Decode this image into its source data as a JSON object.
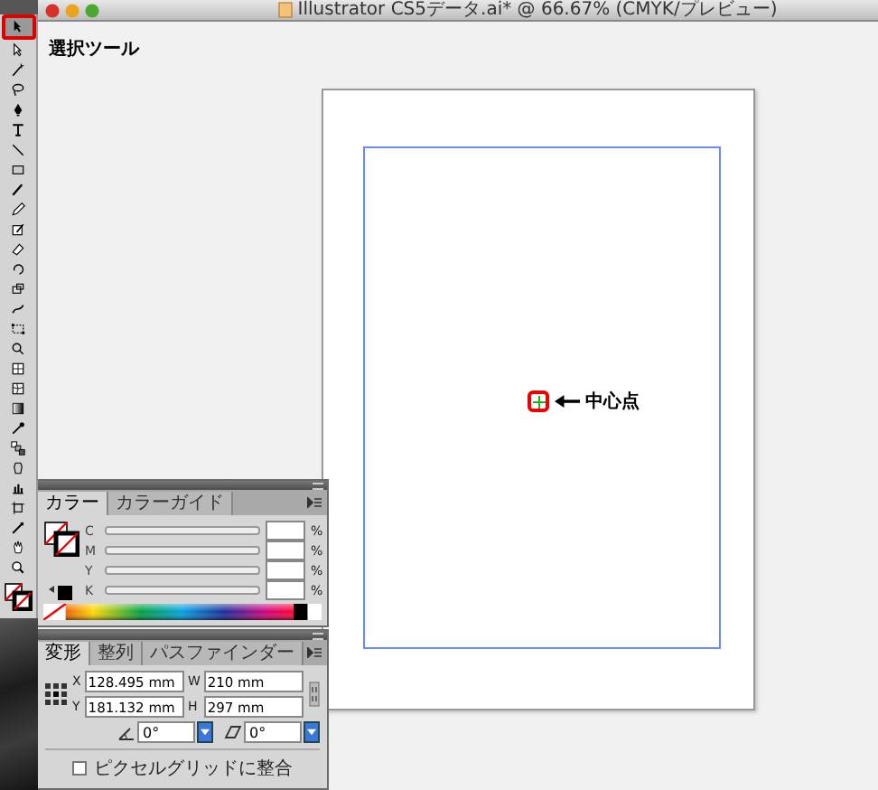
{
  "window": {
    "title": "Illustrator CS5データ.ai* @ 66.67% (CMYK/プレビュー)"
  },
  "tools": [
    {
      "kind": "arrow",
      "selected": true
    },
    {
      "kind": "direct",
      "selected": false
    },
    {
      "kind": "wand",
      "selected": false
    },
    {
      "kind": "lasso",
      "selected": false
    },
    {
      "kind": "pen",
      "selected": false
    },
    {
      "kind": "type",
      "selected": false
    },
    {
      "kind": "line",
      "selected": false
    },
    {
      "kind": "rect",
      "selected": false
    },
    {
      "kind": "brush",
      "selected": false
    },
    {
      "kind": "pencil",
      "selected": false
    },
    {
      "kind": "blob",
      "selected": false
    },
    {
      "kind": "eraser",
      "selected": false
    },
    {
      "kind": "rotate",
      "selected": false
    },
    {
      "kind": "scale",
      "selected": false
    },
    {
      "kind": "warp",
      "selected": false
    },
    {
      "kind": "free",
      "selected": false
    },
    {
      "kind": "shape",
      "selected": false
    },
    {
      "kind": "grid",
      "selected": false
    },
    {
      "kind": "mesh",
      "selected": false
    },
    {
      "kind": "gradient",
      "selected": false
    },
    {
      "kind": "eyedropper",
      "selected": false
    },
    {
      "kind": "blend",
      "selected": false
    },
    {
      "kind": "symbol",
      "selected": false
    },
    {
      "kind": "graph",
      "selected": false
    },
    {
      "kind": "artboard",
      "selected": false
    },
    {
      "kind": "slice",
      "selected": false
    },
    {
      "kind": "hand",
      "selected": false
    },
    {
      "kind": "zoom",
      "selected": false
    }
  ],
  "callouts": [
    {
      "text": "選択ツール"
    },
    {
      "text": "中心点"
    }
  ],
  "color_panel": {
    "tabs": [
      {
        "label": "カラー",
        "selected": true
      },
      {
        "label": "カラーガイド",
        "selected": false
      }
    ],
    "channels": [
      {
        "name": "C",
        "unit": "%"
      },
      {
        "name": "M",
        "unit": "%"
      },
      {
        "name": "Y",
        "unit": "%"
      },
      {
        "name": "K",
        "unit": "%"
      }
    ]
  },
  "transform_panel": {
    "tabs": [
      {
        "label": "変形",
        "selected": true
      },
      {
        "label": "整列",
        "selected": false
      },
      {
        "label": "パスファインダー",
        "selected": false
      }
    ],
    "fields": [
      {
        "label": "X",
        "value": "128.495 mm"
      },
      {
        "label": "W",
        "value": "210 mm"
      },
      {
        "label": "Y",
        "value": "181.132 mm"
      },
      {
        "label": "H",
        "value": "297 mm"
      }
    ],
    "angles": [
      {
        "kind": "rotate",
        "value": "0°"
      },
      {
        "kind": "shear",
        "value": "0°"
      }
    ],
    "snap": {
      "label": "ピクセルグリッドに整合",
      "checked": false
    }
  }
}
